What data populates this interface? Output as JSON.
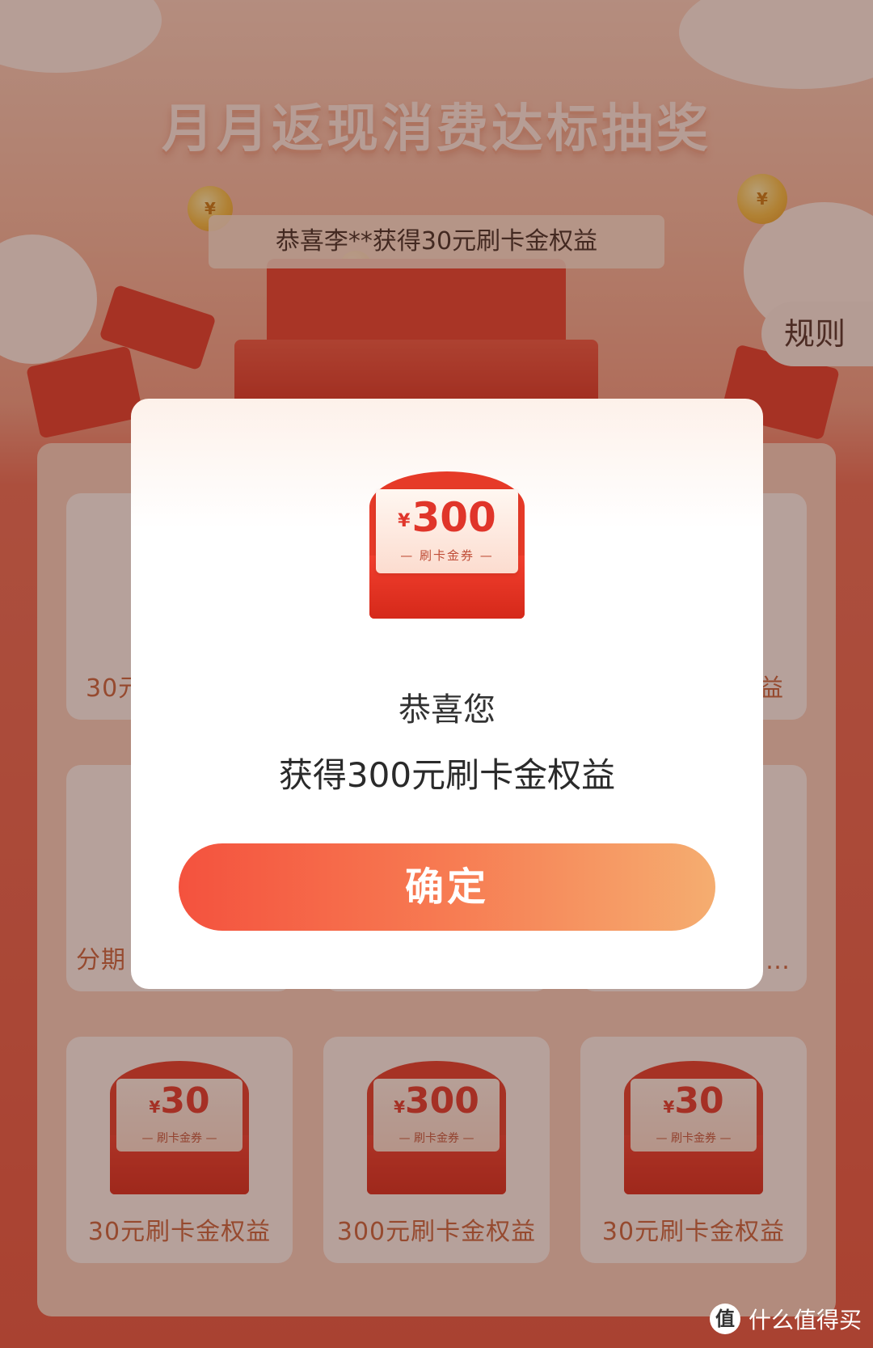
{
  "page": {
    "headline": "月月返现消费达标抽奖",
    "ticker": "恭喜李**获得30元刷卡金权益",
    "rules_label": "规则"
  },
  "grid": {
    "cells": [
      {
        "label": "30元刷卡金权益",
        "amount": "",
        "visible_label": "30元"
      },
      {
        "label": "",
        "amount": ""
      },
      {
        "label": "",
        "amount": "",
        "visible_label": "益"
      },
      {
        "label": "分期…",
        "amount": "",
        "visible_label": "分期"
      },
      {
        "label": "",
        "amount": ""
      },
      {
        "label": "…",
        "amount": "",
        "visible_label": "…"
      },
      {
        "label": "30元刷卡金权益",
        "amount": "30"
      },
      {
        "label": "300元刷卡金权益",
        "amount": "300"
      },
      {
        "label": "30元刷卡金权益",
        "amount": "30"
      }
    ],
    "currency": "¥",
    "voucher_sub": "— 刷卡金券 —"
  },
  "modal": {
    "prize_currency": "¥",
    "prize_amount": "300",
    "prize_sub": "— 刷卡金券 —",
    "message_line1": "恭喜您",
    "message_line2": "获得300元刷卡金权益",
    "confirm_label": "确定"
  },
  "watermark": {
    "logo": "值",
    "text": "什么值得买"
  },
  "colors": {
    "brand_red": "#e63a28",
    "button_start": "#f4523e",
    "button_end": "#f5ad70"
  }
}
